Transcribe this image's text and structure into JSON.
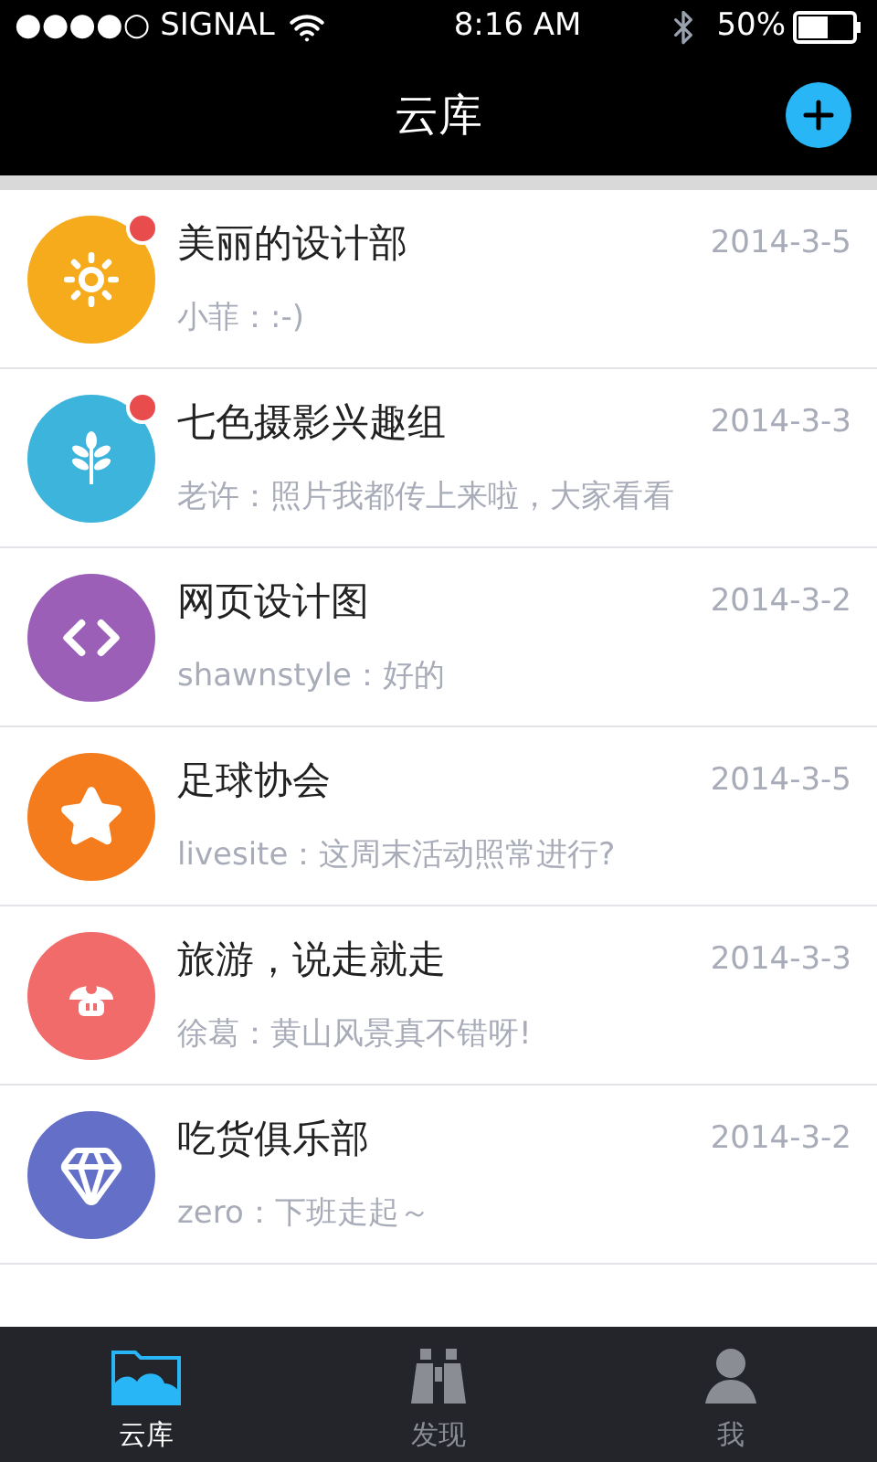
{
  "status_bar": {
    "carrier": "●●●●○ SIGNAL",
    "time": "8:16 AM",
    "battery": "50%"
  },
  "header": {
    "title": "云库"
  },
  "groups": [
    {
      "name": "美丽的设计部",
      "date": "2014-3-5",
      "preview": "小菲：:-)",
      "kind": "sun",
      "color": "#f5ab1c",
      "unread": true
    },
    {
      "name": "七色摄影兴趣组",
      "date": "2014-3-3",
      "preview": "老许：照片我都传上来啦，大家看看",
      "kind": "leaf",
      "color": "#3cb4dc",
      "unread": true
    },
    {
      "name": "网页设计图",
      "date": "2014-3-2",
      "preview": "shawnstyle：好的",
      "kind": "code",
      "color": "#9b5fb8",
      "unread": false
    },
    {
      "name": "足球协会",
      "date": "2014-3-5",
      "preview": "livesite：这周末活动照常进行?",
      "kind": "star",
      "color": "#f57c1c",
      "unread": false
    },
    {
      "name": "旅游，说走就走",
      "date": "2014-3-3",
      "preview": "徐葛：黄山风景真不错呀!",
      "kind": "mushroom",
      "color": "#f26b6b",
      "unread": false
    },
    {
      "name": "吃货俱乐部",
      "date": "2014-3-2",
      "preview": "zero：下班走起～",
      "kind": "diamond",
      "color": "#6470c8",
      "unread": false
    }
  ],
  "tabs": [
    {
      "label": "云库",
      "kind": "folder",
      "selected": true
    },
    {
      "label": "发现",
      "kind": "binoculars",
      "selected": false
    },
    {
      "label": "我",
      "kind": "person",
      "selected": false
    }
  ]
}
